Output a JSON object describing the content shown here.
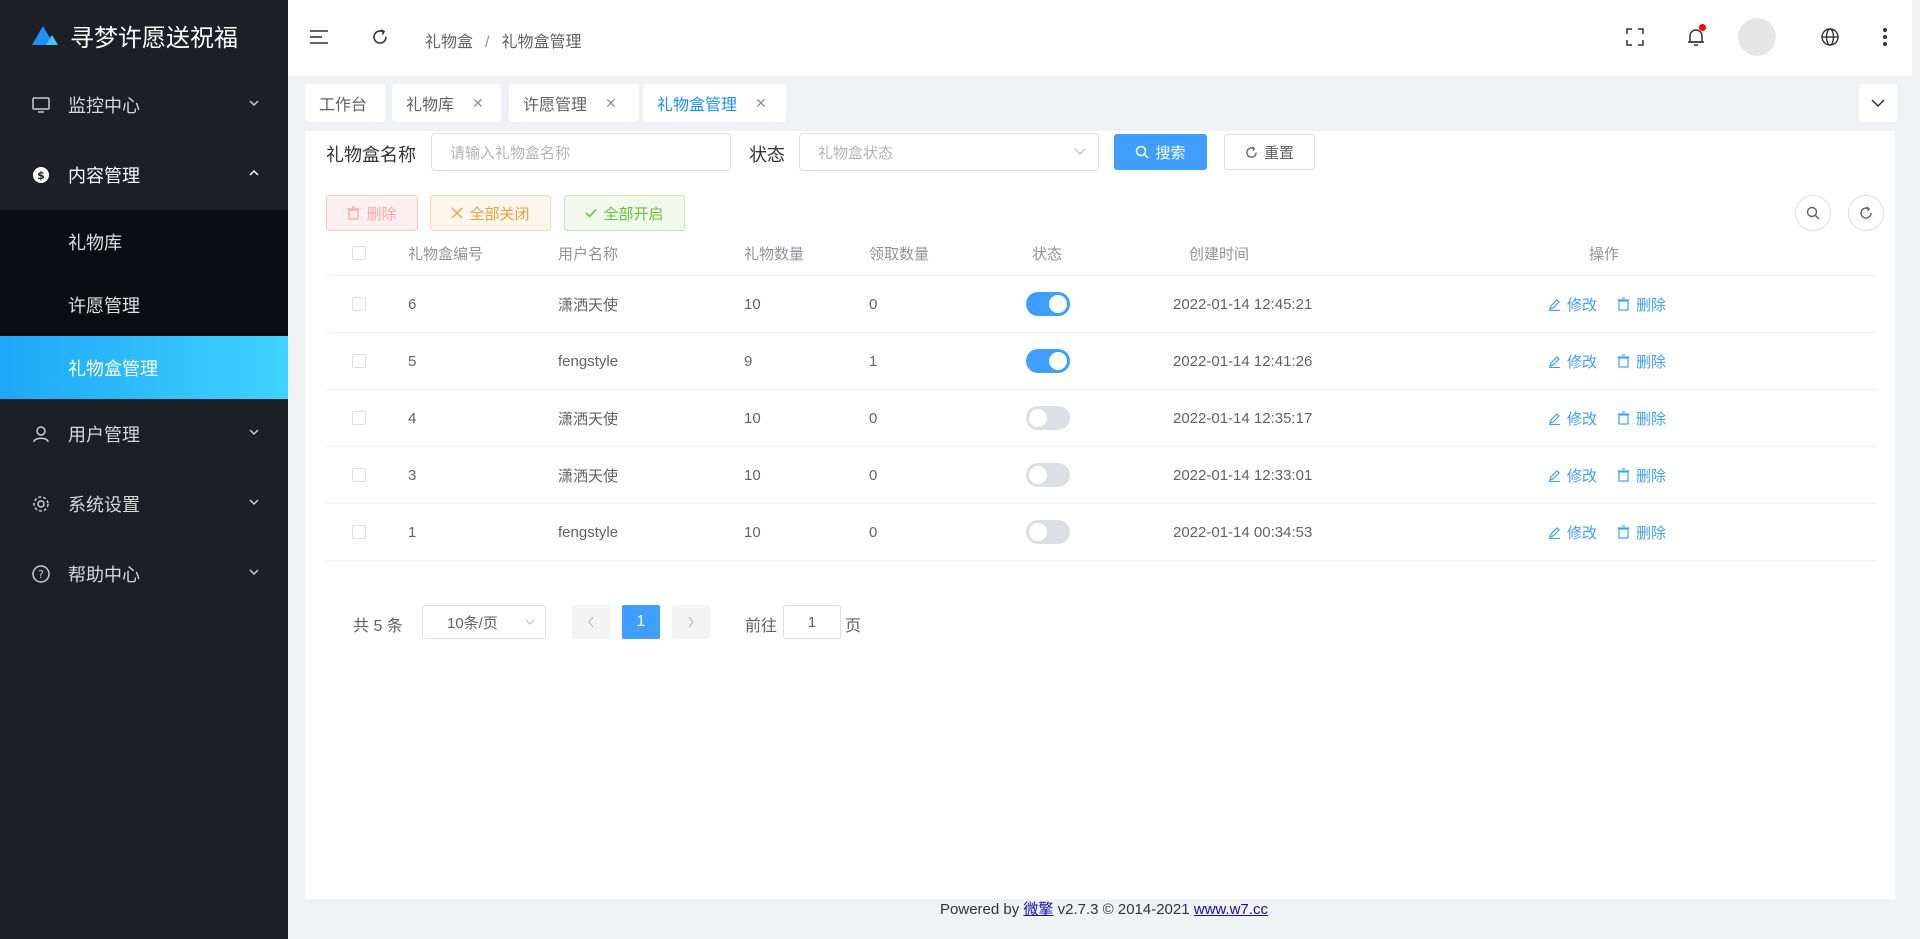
{
  "brand": {
    "title": "寻梦许愿送祝福"
  },
  "sidebar": {
    "items": [
      {
        "label": "监控中心",
        "icon": "monitor-icon"
      },
      {
        "label": "内容管理",
        "icon": "dollar-icon"
      },
      {
        "label": "用户管理",
        "icon": "user-icon"
      },
      {
        "label": "系统设置",
        "icon": "gear-icon"
      },
      {
        "label": "帮助中心",
        "icon": "help-icon"
      }
    ],
    "sub_items": [
      {
        "label": "礼物库"
      },
      {
        "label": "许愿管理"
      },
      {
        "label": "礼物盒管理"
      }
    ]
  },
  "breadcrumb": {
    "first": "礼物盒",
    "sep": "/",
    "second": "礼物盒管理"
  },
  "tabs": [
    {
      "label": "工作台"
    },
    {
      "label": "礼物库",
      "close": "✕"
    },
    {
      "label": "许愿管理",
      "close": "✕"
    },
    {
      "label": "礼物盒管理",
      "close": "✕"
    }
  ],
  "search": {
    "name_label": "礼物盒名称",
    "name_placeholder": "请输入礼物盒名称",
    "status_label": "状态",
    "status_placeholder": "礼物盒状态",
    "search_btn": "搜索",
    "reset_btn": "重置"
  },
  "toolbar": {
    "delete": "删除",
    "close_all": "全部关闭",
    "open_all": "全部开启"
  },
  "table": {
    "headers": [
      "礼物盒编号",
      "用户名称",
      "礼物数量",
      "领取数量",
      "状态",
      "创建时间",
      "操作"
    ],
    "rows": [
      {
        "id": "6",
        "user": "潇洒天使",
        "gifts": "10",
        "received": "0",
        "on": true,
        "created": "2022-01-14 12:45:21"
      },
      {
        "id": "5",
        "user": "fengstyle",
        "gifts": "9",
        "received": "1",
        "on": true,
        "created": "2022-01-14 12:41:26"
      },
      {
        "id": "4",
        "user": "潇洒天使",
        "gifts": "10",
        "received": "0",
        "on": false,
        "created": "2022-01-14 12:35:17"
      },
      {
        "id": "3",
        "user": "潇洒天使",
        "gifts": "10",
        "received": "0",
        "on": false,
        "created": "2022-01-14 12:33:01"
      },
      {
        "id": "1",
        "user": "fengstyle",
        "gifts": "10",
        "received": "0",
        "on": false,
        "created": "2022-01-14 00:34:53"
      }
    ],
    "edit_label": "修改",
    "delete_label": "删除"
  },
  "pagination": {
    "total": "共 5 条",
    "page_size": "10条/页",
    "current": "1",
    "goto_prefix": "前往",
    "goto_value": "1",
    "goto_suffix": "页"
  },
  "footer": {
    "powered": "Powered by ",
    "brand_link": "微擎",
    "version": " v2.7.3 © 2014-2021 ",
    "site_link": "www.w7.cc"
  },
  "colors": {
    "primary": "#409eff",
    "sidebar_bg": "#1d1e26",
    "active_start": "#1ea7f7",
    "active_end": "#3fd3ff"
  }
}
